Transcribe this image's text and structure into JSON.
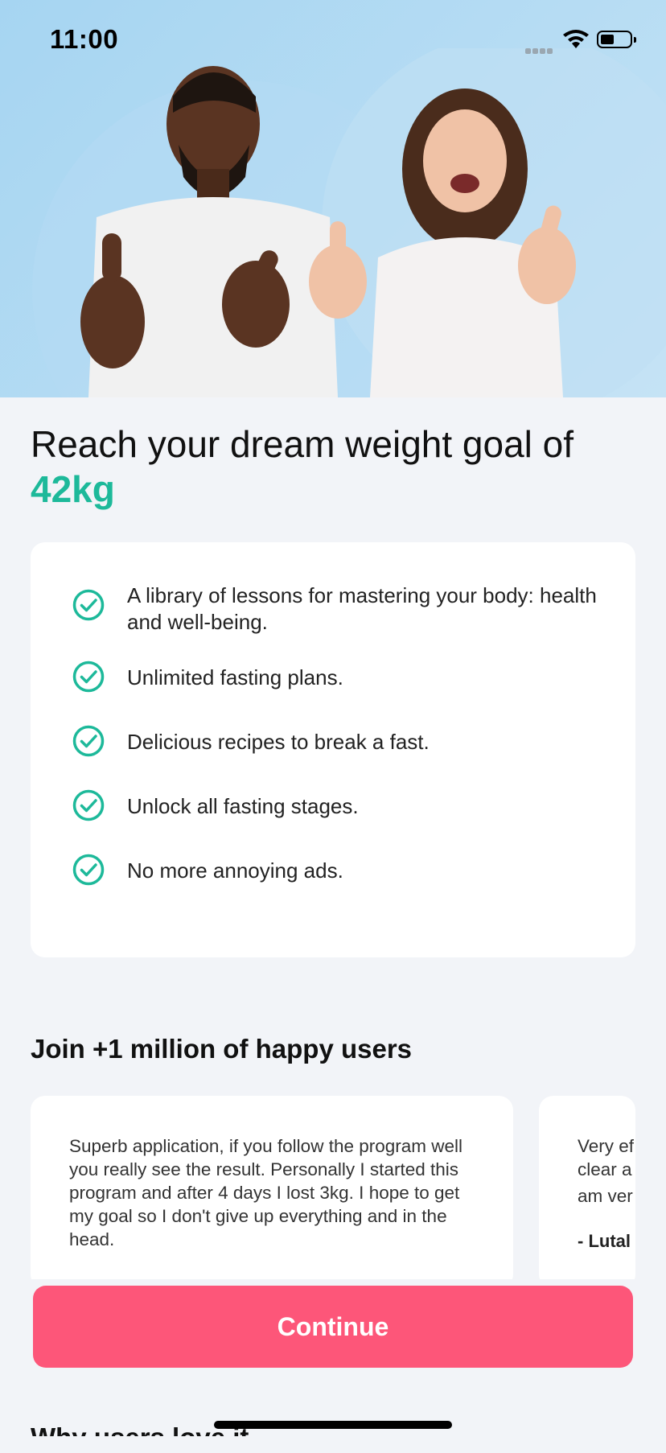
{
  "status_bar": {
    "time": "11:00"
  },
  "hero": {
    "image": "Smiling man and woman in white t-shirts giving thumbs up"
  },
  "headline": {
    "text": "Reach your dream weight goal of",
    "goal_value": "42kg"
  },
  "features": [
    {
      "text": "A library of lessons for mastering your body: health and well-being."
    },
    {
      "text": "Unlimited fasting plans."
    },
    {
      "text": "Delicious recipes to break a fast."
    },
    {
      "text": "Unlock all fasting stages."
    },
    {
      "text": "No more annoying ads."
    }
  ],
  "social_proof": {
    "title": "Join +1 million of happy users",
    "reviews": [
      {
        "text": "Superb application, if you follow the program well you really see the result. Personally I started this program and after 4 days I lost 3kg. I hope to get my goal so I don't give up everything and in the head."
      },
      {
        "line1": "Very ef",
        "line2": "clear a",
        "line3": "am ver",
        "author": "- Lutal"
      }
    ]
  },
  "cta": {
    "label": "Continue"
  },
  "next_section": {
    "heading": "Why users love it"
  },
  "colors": {
    "accent_green": "#1db99a",
    "cta_pink": "#fd5679",
    "background": "#f2f4f8",
    "hero_blue": "#a6d5f2"
  },
  "icons": {
    "check": "check-circle-icon",
    "wifi": "wifi-icon",
    "battery": "battery-icon",
    "signal": "signal-icon"
  }
}
